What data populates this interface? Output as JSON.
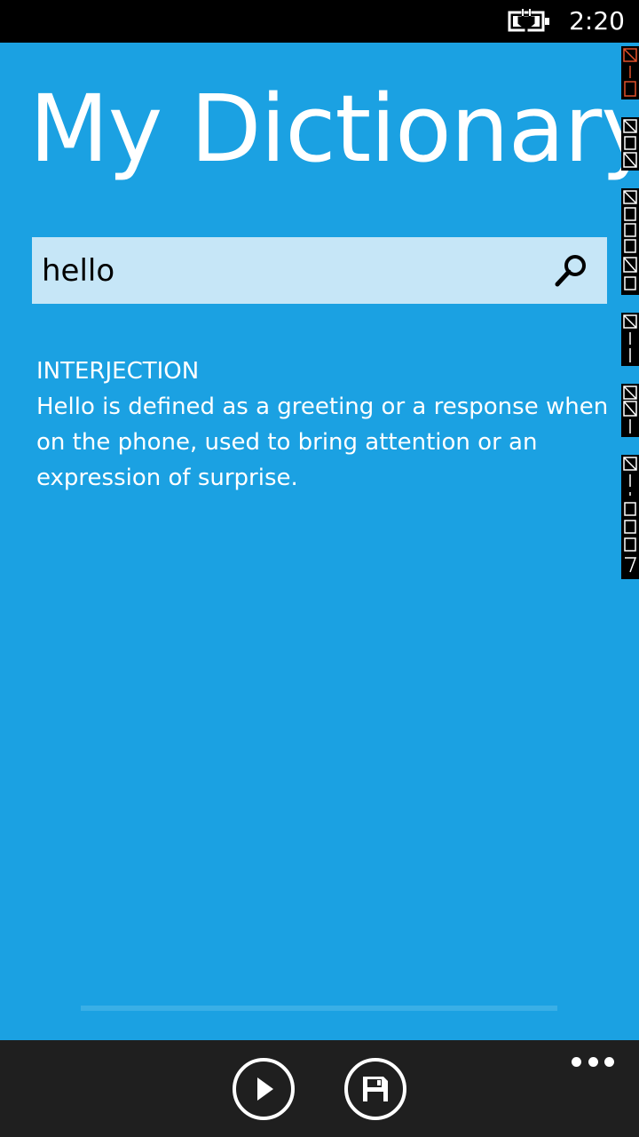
{
  "status_bar": {
    "time": "2:20",
    "battery_icon": "battery-charging-icon"
  },
  "app": {
    "title": "My Dictionary"
  },
  "search": {
    "query": "hello",
    "button_icon": "search-icon"
  },
  "result": {
    "part_of_speech": "INTERJECTION",
    "definition": "Hello is defined as a greeting or a response when on the phone, used to bring attention or an expression of surprise."
  },
  "app_bar": {
    "buttons": [
      {
        "icon": "play-icon"
      },
      {
        "icon": "save-icon"
      }
    ],
    "more_icon": "more-dots-icon"
  },
  "colors": {
    "accent_background": "#1ba1e2",
    "search_field_background": "#c6e6f7",
    "app_bar_background": "#1f1f1f",
    "status_bar_background": "#000000"
  }
}
